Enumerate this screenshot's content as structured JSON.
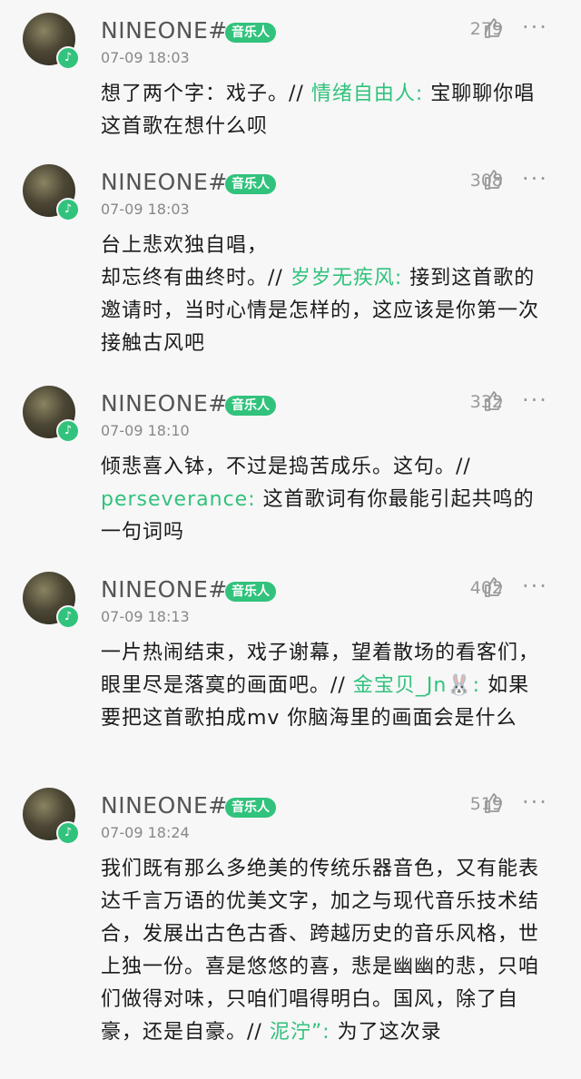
{
  "colors": {
    "accent": "#31c27c",
    "name": "#555555",
    "meta": "#888888",
    "text": "#1b1b1b"
  },
  "icons": {
    "like": "thumb-up-icon",
    "more": "more-icon",
    "badge": "music-note-icon"
  },
  "comments": [
    {
      "user": "NINEONE#",
      "badge": "音乐人",
      "time": "07-09 18:03",
      "likes": "279",
      "text": "想了两个字：戏子。// ",
      "quote_user": "情绪自由人:",
      "quote_text": " 宝聊聊你唱这首歌在想什么呗"
    },
    {
      "user": "NINEONE#",
      "badge": "音乐人",
      "time": "07-09 18:03",
      "likes": "308",
      "text": "台上悲欢独自唱，\n却忘终有曲终时。// ",
      "quote_user": "岁岁无疾风:",
      "quote_text": " 接到这首歌的邀请时，当时心情是怎样的，这应该是你第一次接触古风吧"
    },
    {
      "user": "NINEONE#",
      "badge": "音乐人",
      "time": "07-09 18:10",
      "likes": "332",
      "text": "倾悲喜入钵，不过是捣苦成乐。这句。// ",
      "quote_user": "perseverance:",
      "quote_text": " 这首歌词有你最能引起共鸣的一句词吗"
    },
    {
      "user": "NINEONE#",
      "badge": "音乐人",
      "time": "07-09 18:13",
      "likes": "402",
      "text": "一片热闹结束，戏子谢幕，望着散场的看客们，眼里尽是落寞的画面吧。// ",
      "quote_user": "金宝贝_Jn🐰:",
      "quote_text": " 如果要把这首歌拍成mv 你脑海里的画面会是什么"
    },
    {
      "user": "NINEONE#",
      "badge": "音乐人",
      "time": "07-09 18:24",
      "likes": "519",
      "text": "我们既有那么多绝美的传统乐器音色，又有能表达千言万语的优美文字，加之与现代音乐技术结合，发展出古色古香、跨越历史的音乐风格，世上独一份。喜是悠悠的喜，悲是幽幽的悲，只咱们做得对味，只咱们唱得明白。国风，除了自豪，还是自豪。// ",
      "quote_user": "泥泞”:",
      "quote_text": " 为了这次录"
    }
  ]
}
